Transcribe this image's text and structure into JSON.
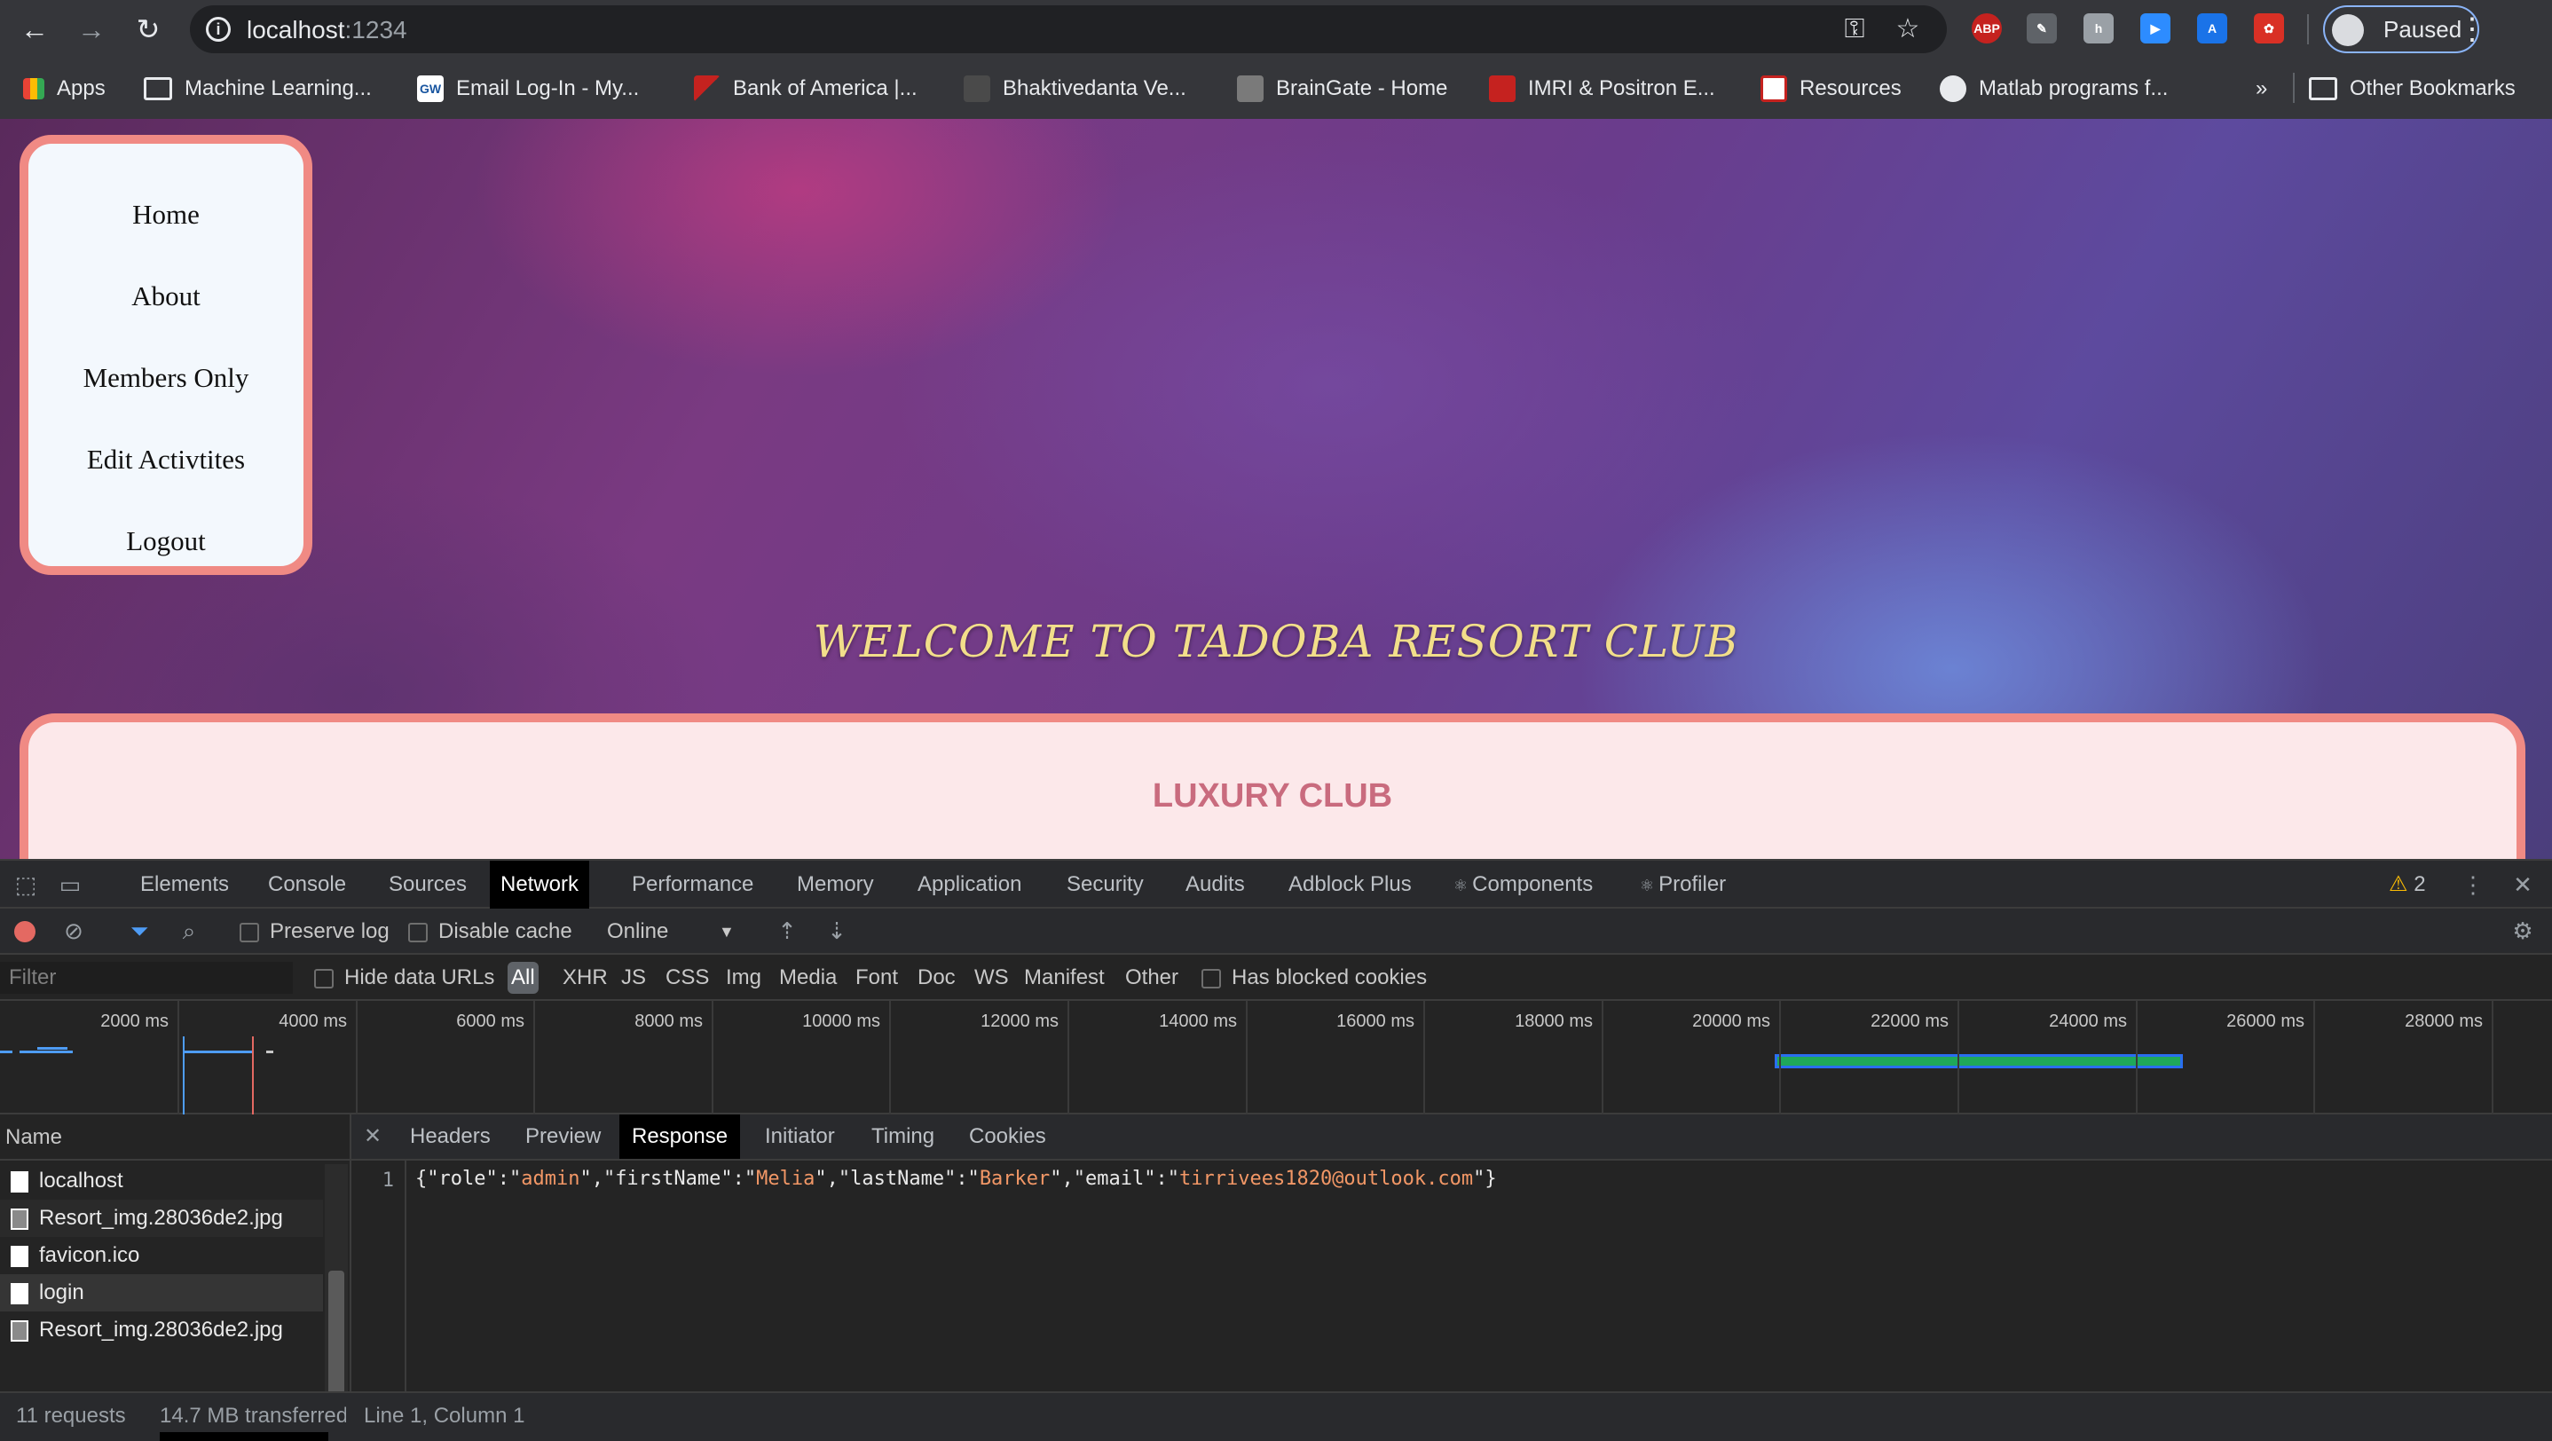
{
  "browser": {
    "url_host": "localhost",
    "url_port": ":1234",
    "profile_label": "Paused",
    "extensions": [
      "ABP"
    ],
    "bookmarks": [
      "Apps",
      "Machine Learning...",
      "Email Log-In - My...",
      "Bank of America |...",
      "Bhaktivedanta Ve...",
      "BrainGate - Home",
      "IMRI & Positron E...",
      "Resources",
      "Matlab programs f..."
    ],
    "bookmarks_overflow": "»",
    "other_bookmarks": "Other Bookmarks",
    "favicon_gw": "GW"
  },
  "site": {
    "nav": [
      "Home",
      "About",
      "Members Only",
      "Edit Activtites",
      "Logout"
    ],
    "welcome": "WELCOME TO TADOBA RESORT CLUB",
    "club_title": "LUXURY CLUB"
  },
  "devtools": {
    "tabs": [
      "Elements",
      "Console",
      "Sources",
      "Network",
      "Performance",
      "Memory",
      "Application",
      "Security",
      "Audits",
      "Adblock Plus",
      "Components",
      "Profiler"
    ],
    "active_tab": "Network",
    "warning_count": "2",
    "toolbar": {
      "preserve_log": "Preserve log",
      "disable_cache": "Disable cache",
      "throttle": "Online"
    },
    "filter": {
      "placeholder": "Filter",
      "hide_data_urls": "Hide data URLs",
      "types": [
        "All",
        "XHR",
        "JS",
        "CSS",
        "Img",
        "Media",
        "Font",
        "Doc",
        "WS",
        "Manifest",
        "Other"
      ],
      "has_blocked_cookies": "Has blocked cookies"
    },
    "timeline_ticks": [
      "2000 ms",
      "4000 ms",
      "6000 ms",
      "8000 ms",
      "10000 ms",
      "12000 ms",
      "14000 ms",
      "16000 ms",
      "18000 ms",
      "20000 ms",
      "22000 ms",
      "24000 ms",
      "26000 ms",
      "28000 ms"
    ],
    "name_header": "Name",
    "requests": [
      {
        "name": "localhost",
        "type": "doc"
      },
      {
        "name": "Resort_img.28036de2.jpg",
        "type": "img"
      },
      {
        "name": "favicon.ico",
        "type": "doc"
      },
      {
        "name": "login",
        "type": "doc"
      },
      {
        "name": "Resort_img.28036de2.jpg",
        "type": "img"
      }
    ],
    "detail_tabs": [
      "Headers",
      "Preview",
      "Response",
      "Initiator",
      "Timing",
      "Cookies"
    ],
    "active_detail_tab": "Response",
    "response_line_no": "1",
    "response": {
      "role": "admin",
      "firstName": "Melia",
      "lastName": "Barker",
      "email": "tirrivees1820@outlook.com"
    },
    "status": {
      "requests": "11 requests",
      "transferred": "14.7 MB transferred",
      "cursor": "Line 1, Column 1"
    }
  },
  "colors": {
    "nav_border": "#f08a84",
    "welcome_text": "#f2de8a",
    "club_title": "#c96b7e",
    "record": "#e46962",
    "json_value": "#f29766"
  }
}
